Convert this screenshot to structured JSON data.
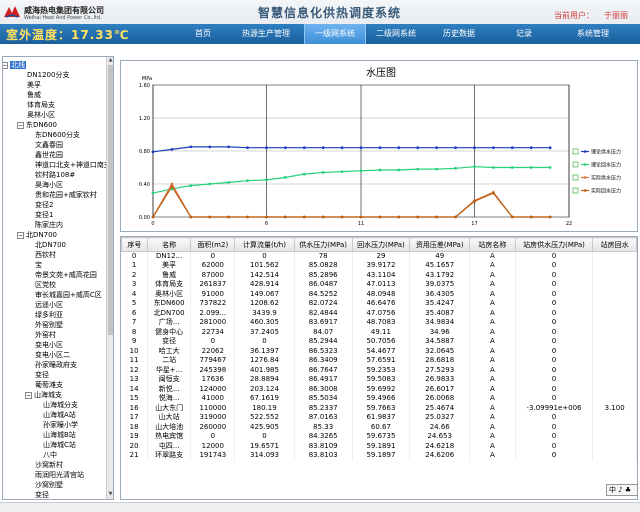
{
  "header": {
    "company_cn": "威海热电集团有限公司",
    "company_en": "Weihai Heat And Power Co.,ltd.",
    "system_title": "智慧信息化供热调度系统",
    "user_label": "当前用户：",
    "user_name": "于丽丽",
    "outdoor_temp": "室外温度：17.33℃"
  },
  "nav": [
    {
      "label": "首页"
    },
    {
      "label": "热源生产管理"
    },
    {
      "label": "一级网系统"
    },
    {
      "label": "二级网系统"
    },
    {
      "label": "历史数据"
    },
    {
      "label": "记录"
    },
    {
      "label": "系统管理"
    }
  ],
  "tree": [
    {
      "label": "北线",
      "level": 0,
      "exp": "−",
      "selected": true
    },
    {
      "label": "DN1200分支",
      "level": 1
    },
    {
      "label": "美孚",
      "level": 1
    },
    {
      "label": "鲁威",
      "level": 1
    },
    {
      "label": "体育局支",
      "level": 1
    },
    {
      "label": "奥林小区",
      "level": 1
    },
    {
      "label": "东DN600",
      "level": 1,
      "exp": "−"
    },
    {
      "label": "东DN600分支",
      "level": 2
    },
    {
      "label": "文鑫春园",
      "level": 2
    },
    {
      "label": "鑫世花园",
      "level": 2
    },
    {
      "label": "神道口北支+神道口南支",
      "level": 2
    },
    {
      "label": "钦村路108#",
      "level": 2
    },
    {
      "label": "昊海小区",
      "level": 2
    },
    {
      "label": "贵和花园+威家钦村",
      "level": 2
    },
    {
      "label": "变径2",
      "level": 2
    },
    {
      "label": "变径1",
      "level": 2
    },
    {
      "label": "陈家庄内",
      "level": 2
    },
    {
      "label": "北DN700",
      "level": 1,
      "exp": "−"
    },
    {
      "label": "北DN700",
      "level": 2
    },
    {
      "label": "西钦村",
      "level": 2
    },
    {
      "label": "宝",
      "level": 2
    },
    {
      "label": "帝景文苑+威高花园",
      "level": 2
    },
    {
      "label": "区党校",
      "level": 2
    },
    {
      "label": "审长城嘉园+威高C区",
      "level": 2
    },
    {
      "label": "远遥小区",
      "level": 2
    },
    {
      "label": "绿多利亚",
      "level": 2
    },
    {
      "label": "外窑别墅",
      "level": 2
    },
    {
      "label": "外窑村",
      "level": 2
    },
    {
      "label": "变电小区",
      "level": 2
    },
    {
      "label": "变电小区二",
      "level": 2
    },
    {
      "label": "孙家疃政府支",
      "level": 2
    },
    {
      "label": "变径",
      "level": 2
    },
    {
      "label": "葡萄滩支",
      "level": 2
    },
    {
      "label": "山海城支",
      "level": 2,
      "exp": "−"
    },
    {
      "label": "山海城分支",
      "level": 3
    },
    {
      "label": "山海城A站",
      "level": 3
    },
    {
      "label": "孙家疃小学",
      "level": 3
    },
    {
      "label": "山海城B站",
      "level": 3
    },
    {
      "label": "山海城C站",
      "level": 3
    },
    {
      "label": "八中",
      "level": 3
    },
    {
      "label": "沙窝新村",
      "level": 2
    },
    {
      "label": "雨润阳光清宫站",
      "level": 2
    },
    {
      "label": "沙窝别墅",
      "level": 2
    },
    {
      "label": "变径",
      "level": 2
    }
  ],
  "chart_data": {
    "type": "line",
    "title": "水压图",
    "ylabel": "MPa",
    "ylim": [
      0,
      1.6
    ],
    "yticks": [
      "0.00",
      "0.40",
      "0.80",
      "1.20",
      "1.60"
    ],
    "xticks": [
      0,
      6,
      11,
      17,
      22
    ],
    "xlim": [
      0,
      22
    ],
    "grid": true,
    "legend_position": "right",
    "series": [
      {
        "name": "理论供水压力",
        "color": "#1f3fbf",
        "marker": "circle",
        "x": [
          0,
          1,
          2,
          3,
          4,
          5,
          6,
          7,
          8,
          9,
          10,
          11,
          12,
          13,
          14,
          15,
          16,
          17,
          18,
          19,
          20,
          21
        ],
        "y": [
          0.79,
          0.82,
          0.85,
          0.85,
          0.85,
          0.84,
          0.84,
          0.84,
          0.84,
          0.84,
          0.84,
          0.84,
          0.84,
          0.84,
          0.84,
          0.84,
          0.84,
          0.84,
          0.84,
          0.84,
          0.84,
          0.84
        ]
      },
      {
        "name": "理论回水压力",
        "color": "#26d07a",
        "marker": "circle",
        "x": [
          0,
          1,
          2,
          3,
          4,
          5,
          6,
          7,
          8,
          9,
          10,
          11,
          12,
          13,
          14,
          15,
          16,
          17,
          18,
          19,
          20,
          21
        ],
        "y": [
          0.29,
          0.34,
          0.38,
          0.4,
          0.42,
          0.44,
          0.45,
          0.48,
          0.52,
          0.54,
          0.55,
          0.56,
          0.57,
          0.57,
          0.58,
          0.58,
          0.59,
          0.61,
          0.6,
          0.6,
          0.6,
          0.6
        ]
      },
      {
        "name": "实际供水压力",
        "color": "#e07040",
        "marker": "circle",
        "x": [
          0,
          1,
          2,
          3,
          4,
          5,
          6,
          7,
          8,
          9,
          10,
          11,
          12,
          13,
          14,
          15,
          16,
          17,
          18,
          19,
          20,
          21
        ],
        "y": [
          0,
          0.4,
          0,
          0,
          0,
          0,
          0,
          0,
          0,
          0,
          0,
          0,
          0,
          0,
          0,
          0,
          0,
          0.2,
          0.3,
          0,
          0,
          0
        ]
      },
      {
        "name": "实际回水压力",
        "color": "#b86010",
        "marker": "circle",
        "x": [
          0,
          1,
          2,
          3,
          4,
          5,
          6,
          7,
          8,
          9,
          10,
          11,
          12,
          13,
          14,
          15,
          16,
          17,
          18,
          19,
          20,
          21
        ],
        "y": [
          0,
          0.37,
          0,
          0,
          0,
          0,
          0,
          0,
          0,
          0,
          0,
          0,
          0,
          0,
          0,
          0,
          0,
          0.19,
          0.29,
          0,
          0,
          0
        ]
      }
    ]
  },
  "table": {
    "columns": [
      "序号",
      "名称",
      "面积(m2)",
      "计算流量(t/h)",
      "供水压力(MPa)",
      "回水压力(MPa)",
      "资用压差(MPa)",
      "站房名称",
      "站房供水压力(MPa)",
      "站房回水"
    ],
    "rows": [
      [
        "0",
        "DN12...",
        "0",
        "0",
        "78",
        "29",
        "49",
        "A",
        "0",
        ""
      ],
      [
        "1",
        "美孚",
        "62000",
        "101.562",
        "85.0828",
        "39.9172",
        "45.1657",
        "A",
        "0",
        ""
      ],
      [
        "2",
        "鲁威",
        "87000",
        "142.514",
        "85.2896",
        "43.1104",
        "43.1792",
        "A",
        "0",
        ""
      ],
      [
        "3",
        "体育局支",
        "261837",
        "428.914",
        "86.0487",
        "47.0113",
        "39.0375",
        "A",
        "0",
        ""
      ],
      [
        "4",
        "奥林小区",
        "91000",
        "149.067",
        "84.5252",
        "48.0948",
        "36.4305",
        "A",
        "0",
        ""
      ],
      [
        "5",
        "东DN600",
        "737822",
        "1208.62",
        "82.0724",
        "46.6476",
        "35.4247",
        "A",
        "0",
        ""
      ],
      [
        "6",
        "北DN700",
        "2.099...",
        "3439.9",
        "82.4844",
        "47.0756",
        "35.4087",
        "A",
        "0",
        ""
      ],
      [
        "7",
        "广场...",
        "281000",
        "460.305",
        "83.6917",
        "48.7083",
        "34.9834",
        "A",
        "0",
        ""
      ],
      [
        "8",
        "健身中心",
        "22734",
        "37.2405",
        "84.07",
        "49.11",
        "34.96",
        "A",
        "0",
        ""
      ],
      [
        "9",
        "变径",
        "0",
        "0",
        "85.2944",
        "50.7056",
        "34.5887",
        "A",
        "0",
        ""
      ],
      [
        "10",
        "哈工大",
        "22062",
        "36.1397",
        "86.5323",
        "54.4677",
        "32.0645",
        "A",
        "0",
        ""
      ],
      [
        "11",
        "二站",
        "779467",
        "1276.84",
        "86.3409",
        "57.6591",
        "28.6818",
        "A",
        "0",
        ""
      ],
      [
        "12",
        "华星+...",
        "245398",
        "401.985",
        "86.7647",
        "59.2353",
        "27.5293",
        "A",
        "0",
        ""
      ],
      [
        "13",
        "闽恒支",
        "17636",
        "28.8894",
        "86.4917",
        "59.5083",
        "26.9833",
        "A",
        "0",
        ""
      ],
      [
        "14",
        "新悦...",
        "124000",
        "203.124",
        "86.3008",
        "59.6992",
        "26.6017",
        "A",
        "0",
        ""
      ],
      [
        "15",
        "悦海...",
        "41000",
        "67.1619",
        "85.5034",
        "59.4966",
        "26.0068",
        "A",
        "0",
        ""
      ],
      [
        "16",
        "山大东门",
        "110000",
        "180.19",
        "85.2337",
        "59.7663",
        "25.4674",
        "A",
        "-3.09991e+006",
        "3.100"
      ],
      [
        "17",
        "山大站",
        "319000",
        "522.552",
        "87.0163",
        "61.9837",
        "25.0327",
        "A",
        "0",
        ""
      ],
      [
        "18",
        "山大培池",
        "260000",
        "425.905",
        "85.33",
        "60.67",
        "24.66",
        "A",
        "0",
        ""
      ],
      [
        "19",
        "热电宾馆",
        "0",
        "0",
        "84.3265",
        "59.6735",
        "24.653",
        "A",
        "0",
        ""
      ],
      [
        "20",
        "屯四...",
        "12000",
        "19.6571",
        "83.8109",
        "59.1891",
        "24.6218",
        "A",
        "0",
        ""
      ],
      [
        "21",
        "环翠路支",
        "191743",
        "314.093",
        "83.8103",
        "59.1897",
        "24.6206",
        "A",
        "0",
        ""
      ]
    ]
  },
  "ime": "中 ♪ ♣"
}
